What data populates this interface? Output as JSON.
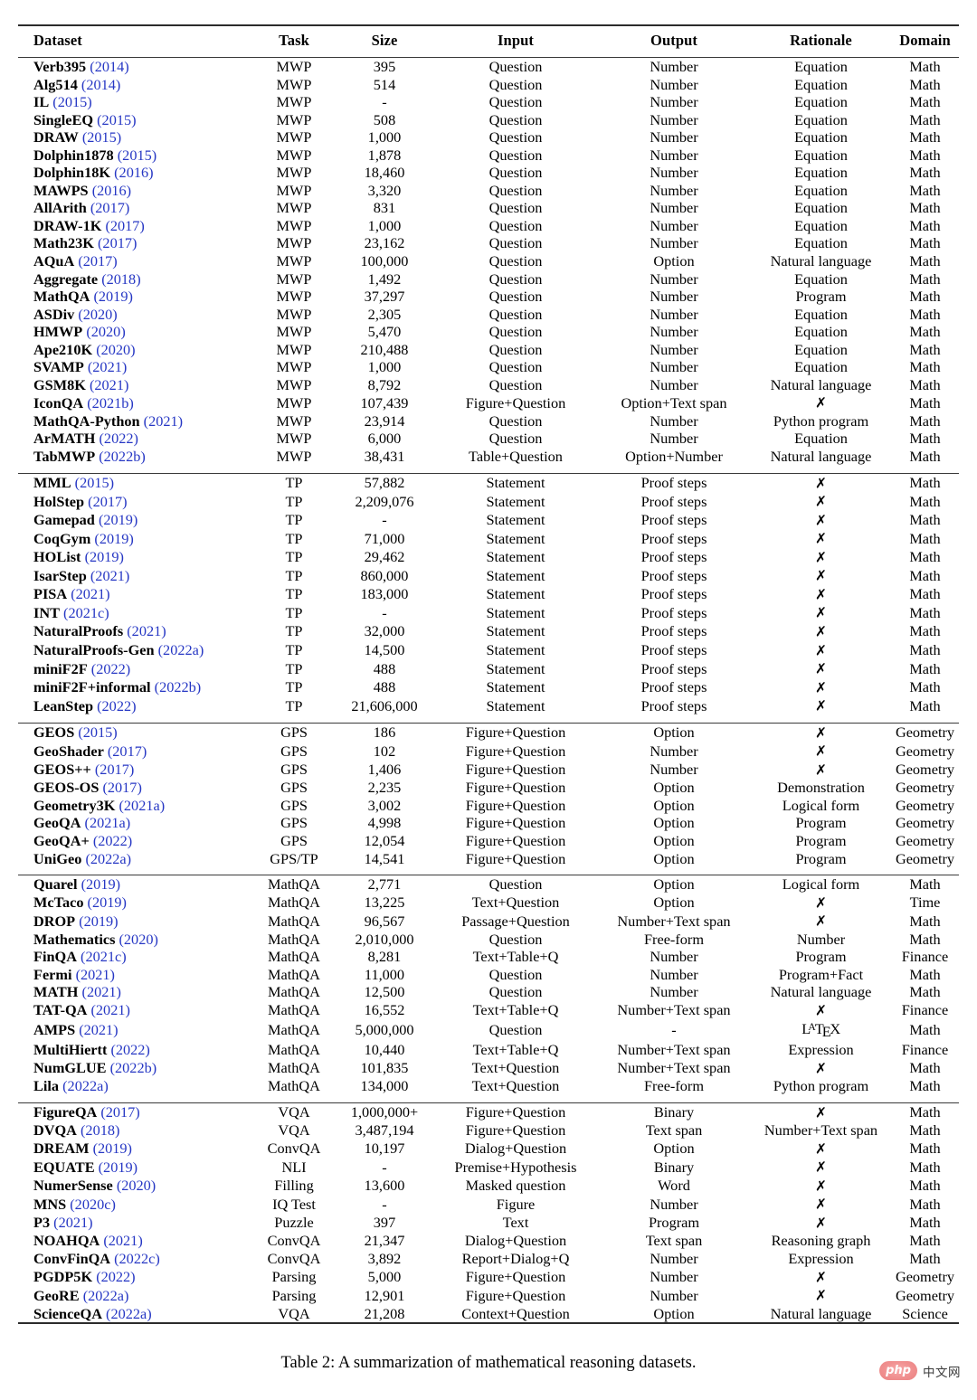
{
  "caption": "Table 2: A summarization of mathematical reasoning datasets.",
  "watermark": {
    "badge": "php",
    "text": "中文网"
  },
  "colors": {
    "year_link": "#2637c4",
    "rule": "#2b2b2b",
    "watermark_pink": "#ef9090"
  },
  "table": {
    "columns": [
      "Dataset",
      "Task",
      "Size",
      "Input",
      "Output",
      "Rationale",
      "Domain"
    ],
    "xmark": "✗",
    "sections": [
      {
        "id": "mwp",
        "rows": [
          {
            "name": "Verb395",
            "year": "(2014)",
            "task": "MWP",
            "size": "395",
            "input": "Question",
            "output": "Number",
            "rationale": "Equation",
            "domain": "Math"
          },
          {
            "name": "Alg514",
            "year": "(2014)",
            "task": "MWP",
            "size": "514",
            "input": "Question",
            "output": "Number",
            "rationale": "Equation",
            "domain": "Math"
          },
          {
            "name": "IL",
            "year": "(2015)",
            "task": "MWP",
            "size": "-",
            "input": "Question",
            "output": "Number",
            "rationale": "Equation",
            "domain": "Math"
          },
          {
            "name": "SingleEQ",
            "year": "(2015)",
            "task": "MWP",
            "size": "508",
            "input": "Question",
            "output": "Number",
            "rationale": "Equation",
            "domain": "Math"
          },
          {
            "name": "DRAW",
            "year": "(2015)",
            "task": "MWP",
            "size": "1,000",
            "input": "Question",
            "output": "Number",
            "rationale": "Equation",
            "domain": "Math"
          },
          {
            "name": "Dolphin1878",
            "year": "(2015)",
            "task": "MWP",
            "size": "1,878",
            "input": "Question",
            "output": "Number",
            "rationale": "Equation",
            "domain": "Math"
          },
          {
            "name": "Dolphin18K",
            "year": "(2016)",
            "task": "MWP",
            "size": "18,460",
            "input": "Question",
            "output": "Number",
            "rationale": "Equation",
            "domain": "Math"
          },
          {
            "name": "MAWPS",
            "year": "(2016)",
            "task": "MWP",
            "size": "3,320",
            "input": "Question",
            "output": "Number",
            "rationale": "Equation",
            "domain": "Math"
          },
          {
            "name": "AllArith",
            "year": "(2017)",
            "task": "MWP",
            "size": "831",
            "input": "Question",
            "output": "Number",
            "rationale": "Equation",
            "domain": "Math"
          },
          {
            "name": "DRAW-1K",
            "year": "(2017)",
            "task": "MWP",
            "size": "1,000",
            "input": "Question",
            "output": "Number",
            "rationale": "Equation",
            "domain": "Math"
          },
          {
            "name": "Math23K",
            "year": "(2017)",
            "task": "MWP",
            "size": "23,162",
            "input": "Question",
            "output": "Number",
            "rationale": "Equation",
            "domain": "Math"
          },
          {
            "name": "AQuA",
            "year": "(2017)",
            "task": "MWP",
            "size": "100,000",
            "input": "Question",
            "output": "Option",
            "rationale": "Natural language",
            "domain": "Math"
          },
          {
            "name": "Aggregate",
            "year": "(2018)",
            "task": "MWP",
            "size": "1,492",
            "input": "Question",
            "output": "Number",
            "rationale": "Equation",
            "domain": "Math"
          },
          {
            "name": "MathQA",
            "year": "(2019)",
            "task": "MWP",
            "size": "37,297",
            "input": "Question",
            "output": "Number",
            "rationale": "Program",
            "domain": "Math"
          },
          {
            "name": "ASDiv",
            "year": "(2020)",
            "task": "MWP",
            "size": "2,305",
            "input": "Question",
            "output": "Number",
            "rationale": "Equation",
            "domain": "Math"
          },
          {
            "name": "HMWP",
            "year": "(2020)",
            "task": "MWP",
            "size": "5,470",
            "input": "Question",
            "output": "Number",
            "rationale": "Equation",
            "domain": "Math"
          },
          {
            "name": "Ape210K",
            "year": "(2020)",
            "task": "MWP",
            "size": "210,488",
            "input": "Question",
            "output": "Number",
            "rationale": "Equation",
            "domain": "Math"
          },
          {
            "name": "SVAMP",
            "year": "(2021)",
            "task": "MWP",
            "size": "1,000",
            "input": "Question",
            "output": "Number",
            "rationale": "Equation",
            "domain": "Math"
          },
          {
            "name": "GSM8K",
            "year": "(2021)",
            "task": "MWP",
            "size": "8,792",
            "input": "Question",
            "output": "Number",
            "rationale": "Natural language",
            "domain": "Math"
          },
          {
            "name": "IconQA",
            "year": "(2021b)",
            "task": "MWP",
            "size": "107,439",
            "input": "Figure+Question",
            "output": "Option+Text span",
            "rationale": "✗",
            "domain": "Math"
          },
          {
            "name": "MathQA-Python",
            "year": "(2021)",
            "task": "MWP",
            "size": "23,914",
            "input": "Question",
            "output": "Number",
            "rationale": "Python program",
            "domain": "Math"
          },
          {
            "name": "ArMATH",
            "year": "(2022)",
            "task": "MWP",
            "size": "6,000",
            "input": "Question",
            "output": "Number",
            "rationale": "Equation",
            "domain": "Math"
          },
          {
            "name": "TabMWP",
            "year": "(2022b)",
            "task": "MWP",
            "size": "38,431",
            "input": "Table+Question",
            "output": "Option+Number",
            "rationale": "Natural language",
            "domain": "Math"
          }
        ]
      },
      {
        "id": "tp",
        "rows": [
          {
            "name": "MML",
            "year": "(2015)",
            "task": "TP",
            "size": "57,882",
            "input": "Statement",
            "output": "Proof steps",
            "rationale": "✗",
            "domain": "Math"
          },
          {
            "name": "HolStep",
            "year": "(2017)",
            "task": "TP",
            "size": "2,209,076",
            "input": "Statement",
            "output": "Proof steps",
            "rationale": "✗",
            "domain": "Math"
          },
          {
            "name": "Gamepad",
            "year": "(2019)",
            "task": "TP",
            "size": "-",
            "input": "Statement",
            "output": "Proof steps",
            "rationale": "✗",
            "domain": "Math"
          },
          {
            "name": "CoqGym",
            "year": "(2019)",
            "task": "TP",
            "size": "71,000",
            "input": "Statement",
            "output": "Proof steps",
            "rationale": "✗",
            "domain": "Math"
          },
          {
            "name": "HOList",
            "year": "(2019)",
            "task": "TP",
            "size": "29,462",
            "input": "Statement",
            "output": "Proof steps",
            "rationale": "✗",
            "domain": "Math"
          },
          {
            "name": "IsarStep",
            "year": "(2021)",
            "task": "TP",
            "size": "860,000",
            "input": "Statement",
            "output": "Proof steps",
            "rationale": "✗",
            "domain": "Math"
          },
          {
            "name": "PISA",
            "year": "(2021)",
            "task": "TP",
            "size": "183,000",
            "input": "Statement",
            "output": "Proof steps",
            "rationale": "✗",
            "domain": "Math"
          },
          {
            "name": "INT",
            "year": "(2021c)",
            "task": "TP",
            "size": "-",
            "input": "Statement",
            "output": "Proof steps",
            "rationale": "✗",
            "domain": "Math"
          },
          {
            "name": "NaturalProofs",
            "year": "(2021)",
            "task": "TP",
            "size": "32,000",
            "input": "Statement",
            "output": "Proof steps",
            "rationale": "✗",
            "domain": "Math"
          },
          {
            "name": "NaturalProofs-Gen",
            "year": "(2022a)",
            "task": "TP",
            "size": "14,500",
            "input": "Statement",
            "output": "Proof steps",
            "rationale": "✗",
            "domain": "Math"
          },
          {
            "name": "miniF2F",
            "year": "(2022)",
            "task": "TP",
            "size": "488",
            "input": "Statement",
            "output": "Proof steps",
            "rationale": "✗",
            "domain": "Math"
          },
          {
            "name": "miniF2F+informal",
            "year": "(2022b)",
            "task": "TP",
            "size": "488",
            "input": "Statement",
            "output": "Proof steps",
            "rationale": "✗",
            "domain": "Math"
          },
          {
            "name": "LeanStep",
            "year": "(2022)",
            "task": "TP",
            "size": "21,606,000",
            "input": "Statement",
            "output": "Proof steps",
            "rationale": "✗",
            "domain": "Math"
          }
        ]
      },
      {
        "id": "gps",
        "rows": [
          {
            "name": "GEOS",
            "year": "(2015)",
            "task": "GPS",
            "size": "186",
            "input": "Figure+Question",
            "output": "Option",
            "rationale": "✗",
            "domain": "Geometry"
          },
          {
            "name": "GeoShader",
            "year": "(2017)",
            "task": "GPS",
            "size": "102",
            "input": "Figure+Question",
            "output": "Number",
            "rationale": "✗",
            "domain": "Geometry"
          },
          {
            "name": "GEOS++",
            "year": "(2017)",
            "task": "GPS",
            "size": "1,406",
            "input": "Figure+Question",
            "output": "Number",
            "rationale": "✗",
            "domain": "Geometry"
          },
          {
            "name": "GEOS-OS",
            "year": "(2017)",
            "task": "GPS",
            "size": "2,235",
            "input": "Figure+Question",
            "output": "Option",
            "rationale": "Demonstration",
            "domain": "Geometry"
          },
          {
            "name": "Geometry3K",
            "year": "(2021a)",
            "task": "GPS",
            "size": "3,002",
            "input": "Figure+Question",
            "output": "Option",
            "rationale": "Logical form",
            "domain": "Geometry"
          },
          {
            "name": "GeoQA",
            "year": "(2021a)",
            "task": "GPS",
            "size": "4,998",
            "input": "Figure+Question",
            "output": "Option",
            "rationale": "Program",
            "domain": "Geometry"
          },
          {
            "name": "GeoQA+",
            "year": "(2022)",
            "task": "GPS",
            "size": "12,054",
            "input": "Figure+Question",
            "output": "Option",
            "rationale": "Program",
            "domain": "Geometry"
          },
          {
            "name": "UniGeo",
            "year": "(2022a)",
            "task": "GPS/TP",
            "size": "14,541",
            "input": "Figure+Question",
            "output": "Option",
            "rationale": "Program",
            "domain": "Geometry"
          }
        ]
      },
      {
        "id": "mathqa",
        "rows": [
          {
            "name": "Quarel",
            "year": "(2019)",
            "task": "MathQA",
            "size": "2,771",
            "input": "Question",
            "output": "Option",
            "rationale": "Logical form",
            "domain": "Math"
          },
          {
            "name": "McTaco",
            "year": "(2019)",
            "task": "MathQA",
            "size": "13,225",
            "input": "Text+Question",
            "output": "Option",
            "rationale": "✗",
            "domain": "Time"
          },
          {
            "name": "DROP",
            "year": "(2019)",
            "task": "MathQA",
            "size": "96,567",
            "input": "Passage+Question",
            "output": "Number+Text span",
            "rationale": "✗",
            "domain": "Math"
          },
          {
            "name": "Mathematics",
            "year": "(2020)",
            "task": "MathQA",
            "size": "2,010,000",
            "input": "Question",
            "output": "Free-form",
            "rationale": "Number",
            "domain": "Math"
          },
          {
            "name": "FinQA",
            "year": "(2021c)",
            "task": "MathQA",
            "size": "8,281",
            "input": "Text+Table+Q",
            "output": "Number",
            "rationale": "Program",
            "domain": "Finance"
          },
          {
            "name": "Fermi",
            "year": "(2021)",
            "task": "MathQA",
            "size": "11,000",
            "input": "Question",
            "output": "Number",
            "rationale": "Program+Fact",
            "domain": "Math"
          },
          {
            "name": "MATH",
            "year": "(2021)",
            "task": "MathQA",
            "size": "12,500",
            "input": "Question",
            "output": "Number",
            "rationale": "Natural language",
            "domain": "Math"
          },
          {
            "name": "TAT-QA",
            "year": "(2021)",
            "task": "MathQA",
            "size": "16,552",
            "input": "Text+Table+Q",
            "output": "Number+Text span",
            "rationale": "✗",
            "domain": "Finance"
          },
          {
            "name": "AMPS",
            "year": "(2021)",
            "task": "MathQA",
            "size": "5,000,000",
            "input": "Question",
            "output": "-",
            "rationale": "LaTeX",
            "domain": "Math"
          },
          {
            "name": "MultiHiertt",
            "year": "(2022)",
            "task": "MathQA",
            "size": "10,440",
            "input": "Text+Table+Q",
            "output": "Number+Text span",
            "rationale": "Expression",
            "domain": "Finance"
          },
          {
            "name": "NumGLUE",
            "year": "(2022b)",
            "task": "MathQA",
            "size": "101,835",
            "input": "Text+Question",
            "output": "Number+Text span",
            "rationale": "✗",
            "domain": "Math"
          },
          {
            "name": "Lila",
            "year": "(2022a)",
            "task": "MathQA",
            "size": "134,000",
            "input": "Text+Question",
            "output": "Free-form",
            "rationale": "Python program",
            "domain": "Math"
          }
        ]
      },
      {
        "id": "other",
        "rows": [
          {
            "name": "FigureQA",
            "year": "(2017)",
            "task": "VQA",
            "size": "1,000,000+",
            "input": "Figure+Question",
            "output": "Binary",
            "rationale": "✗",
            "domain": "Math"
          },
          {
            "name": "DVQA",
            "year": "(2018)",
            "task": "VQA",
            "size": "3,487,194",
            "input": "Figure+Question",
            "output": "Text span",
            "rationale": "Number+Text span",
            "domain": "Math"
          },
          {
            "name": "DREAM",
            "year": "(2019)",
            "task": "ConvQA",
            "size": "10,197",
            "input": "Dialog+Question",
            "output": "Option",
            "rationale": "✗",
            "domain": "Math"
          },
          {
            "name": "EQUATE",
            "year": "(2019)",
            "task": "NLI",
            "size": "-",
            "input": "Premise+Hypothesis",
            "output": "Binary",
            "rationale": "✗",
            "domain": "Math"
          },
          {
            "name": "NumerSense",
            "year": "(2020)",
            "task": "Filling",
            "size": "13,600",
            "input": "Masked question",
            "output": "Word",
            "rationale": "✗",
            "domain": "Math"
          },
          {
            "name": "MNS",
            "year": "(2020c)",
            "task": "IQ Test",
            "size": "-",
            "input": "Figure",
            "output": "Number",
            "rationale": "✗",
            "domain": "Math"
          },
          {
            "name": "P3",
            "year": "(2021)",
            "task": "Puzzle",
            "size": "397",
            "input": "Text",
            "output": "Program",
            "rationale": "✗",
            "domain": "Math"
          },
          {
            "name": "NOAHQA",
            "year": "(2021)",
            "task": "ConvQA",
            "size": "21,347",
            "input": "Dialog+Question",
            "output": "Text span",
            "rationale": "Reasoning graph",
            "domain": "Math"
          },
          {
            "name": "ConvFinQA",
            "year": "(2022c)",
            "task": "ConvQA",
            "size": "3,892",
            "input": "Report+Dialog+Q",
            "output": "Number",
            "rationale": "Expression",
            "domain": "Math"
          },
          {
            "name": "PGDP5K",
            "year": "(2022)",
            "task": "Parsing",
            "size": "5,000",
            "input": "Figure+Question",
            "output": "Number",
            "rationale": "✗",
            "domain": "Geometry"
          },
          {
            "name": "GeoRE",
            "year": "(2022a)",
            "task": "Parsing",
            "size": "12,901",
            "input": "Figure+Question",
            "output": "Number",
            "rationale": "✗",
            "domain": "Geometry"
          },
          {
            "name": "ScienceQA",
            "year": "(2022a)",
            "task": "VQA",
            "size": "21,208",
            "input": "Context+Question",
            "output": "Option",
            "rationale": "Natural language",
            "domain": "Science"
          }
        ]
      }
    ]
  }
}
